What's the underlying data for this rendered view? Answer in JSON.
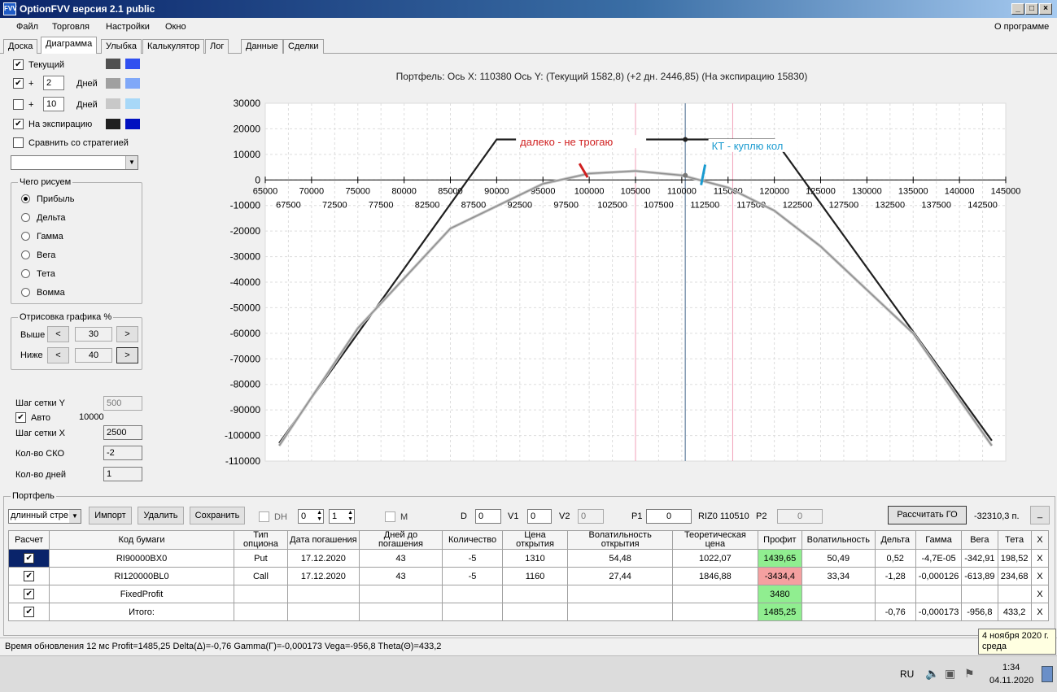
{
  "window": {
    "title": "OptionFVV версия 2.1 public",
    "min": "_",
    "max": "□",
    "close": "×"
  },
  "menu": {
    "items": [
      "Файл",
      "Торговля",
      "Настройки",
      "Окно"
    ],
    "about": "О программе"
  },
  "tabs": [
    "Доска",
    "Диаграмма",
    "Улыбка",
    "Калькулятор",
    "Лог",
    "Данные",
    "Сделки"
  ],
  "left": {
    "current": {
      "label": "Текущий",
      "checked": true,
      "c1": "#505050",
      "c2": "#3050f0"
    },
    "plus1": {
      "plus": "+",
      "days": "2",
      "unit": "Дней",
      "checked": true,
      "c1": "#a0a0a0",
      "c2": "#80a8f8"
    },
    "plus2": {
      "plus": "+",
      "days": "10",
      "unit": "Дней",
      "checked": false,
      "c1": "#c8c8c8",
      "c2": "#a8d8f8"
    },
    "expiry": {
      "label": "На экспирацию",
      "checked": true,
      "c1": "#202020",
      "c2": "#0010c0"
    },
    "compare": {
      "label": "Сравнить со стратегией",
      "checked": false
    },
    "what": {
      "title": "Чего рисуем",
      "options": [
        "Прибыль",
        "Дельта",
        "Гамма",
        "Вега",
        "Тета",
        "Вомма"
      ],
      "selected": 0
    },
    "draw": {
      "title": "Отрисовка графика %",
      "above_label": "Выше",
      "above": "30",
      "below_label": "Ниже",
      "below": "40",
      "prev": "<",
      "next": ">"
    },
    "grid": {
      "y_label": "Шаг сетки Y",
      "y": "500",
      "auto_label": "Авто",
      "auto": true,
      "auto_value": "10000",
      "x_label": "Шаг сетки X",
      "x": "2500",
      "sko_label": "Кол-во СКО",
      "sko": "-2",
      "days_label": "Кол-во дней",
      "days": "1"
    }
  },
  "chart_data": {
    "type": "line",
    "title": "Портфель: Ось X:  110380 Ось Y:   (Текущий 1582,8)  (+2 дн. 2446,85)  (На экспирацию 15830)",
    "xlim": [
      65000,
      145000
    ],
    "ylim": [
      -110000,
      30000
    ],
    "x_ticks_upper": [
      "65000",
      "70000",
      "75000",
      "80000",
      "85000",
      "90000",
      "95000",
      "100000",
      "105000",
      "110000",
      "115000",
      "120000",
      "125000",
      "130000",
      "135000",
      "140000",
      "145000"
    ],
    "x_ticks_lower": [
      "67500",
      "72500",
      "77500",
      "82500",
      "87500",
      "92500",
      "97500",
      "102500",
      "107500",
      "112500",
      "117500",
      "122500",
      "127500",
      "132500",
      "137500",
      "142500"
    ],
    "y_ticks": [
      "30000",
      "20000",
      "10000",
      "0",
      "-10000",
      "-20000",
      "-30000",
      "-40000",
      "-50000",
      "-60000",
      "-70000",
      "-80000",
      "-100000",
      "-110000",
      "-90000"
    ],
    "y_tick_values": [
      30000,
      20000,
      10000,
      0,
      -10000,
      -20000,
      -30000,
      -40000,
      -50000,
      -60000,
      -70000,
      -80000,
      -100000,
      -110000,
      -90000
    ],
    "cursor_x": 110380,
    "vlines": [
      105000,
      115500
    ],
    "series": [
      {
        "x": [
          66500,
          90000,
          120000,
          143500
        ],
        "y": [
          -103000,
          15830,
          15830,
          -102000
        ],
        "color": "#202020"
      },
      {
        "x": [
          66500,
          75000,
          85000,
          95000,
          100000,
          105000,
          110000,
          115000,
          120000,
          125000,
          135000,
          143500
        ],
        "y": [
          -104000,
          -58000,
          -19000,
          -1500,
          2500,
          3500,
          1800,
          -3000,
          -12000,
          -26000,
          -60000,
          -104000
        ],
        "color": "#909090"
      }
    ],
    "annotations": [
      {
        "text": "далеко - не трогаю",
        "color": "#d02020",
        "x": 100000,
        "y": 3000
      },
      {
        "text": "КТ - куплю кол",
        "color": "#1a9bd0",
        "x": 112000,
        "y": 0
      }
    ]
  },
  "portfolio": {
    "title": "Портфель",
    "select": "длинный стре",
    "import": "Импорт",
    "delete": "Удалить",
    "save": "Сохранить",
    "dh": "DH",
    "dh_v1": "0",
    "dh_v2": "1",
    "m": "M",
    "d_label": "D",
    "d": "0",
    "v1_label": "V1",
    "v1": "0",
    "v2_label": "V2",
    "v2": "0",
    "p1_label": "P1",
    "p1": "0",
    "riz": "RIZ0 110510",
    "p2_label": "P2",
    "p2": "0",
    "calc": "Рассчитать ГО",
    "go": "-32310,3 п.",
    "minus": "_",
    "headers": [
      "Расчет",
      "Код бумаги",
      "Тип опциона",
      "Дата погашения",
      "Дней до погашения",
      "Количество",
      "Цена открытия",
      "Волатильность открытия",
      "Теоретическая цена",
      "Профит",
      "Волатильность",
      "Дельта",
      "Гамма",
      "Вега",
      "Тета",
      "X"
    ],
    "rows": [
      [
        "RI90000BX0",
        "Put",
        "17.12.2020",
        "43",
        "-5",
        "1310",
        "54,48",
        "1022,07",
        "1439,65",
        "50,49",
        "0,52",
        "-4,7E-05",
        "-342,91",
        "198,52",
        "X"
      ],
      [
        "RI120000BL0",
        "Call",
        "17.12.2020",
        "43",
        "-5",
        "1160",
        "27,44",
        "1846,88",
        "-3434,4",
        "33,34",
        "-1,28",
        "-0,000126",
        "-613,89",
        "234,68",
        "X"
      ],
      [
        "FixedProfit",
        "",
        "",
        "",
        "",
        "",
        "",
        "",
        "3480",
        "",
        "",
        "",
        "",
        "",
        "X"
      ],
      [
        "Итого:",
        "",
        "",
        "",
        "",
        "",
        "",
        "",
        "1485,25",
        "",
        "-0,76",
        "-0,000173",
        "-956,8",
        "433,2",
        "X"
      ]
    ],
    "profit_colors": [
      "#90ee90",
      "#f4a0a0",
      "#90ee90",
      "#90ee90"
    ]
  },
  "status": {
    "text": "Время обновления 12 мс  Profit=1485,25 Delta(Δ)=-0,76 Gamma(Γ)=-0,000173 Vega=-956,8 Theta(Θ)=433,2"
  },
  "tooltip": {
    "line1": "4 ноября 2020 г.",
    "line2": "среда"
  },
  "taskbar": {
    "lang": "RU",
    "time": "1:34",
    "date": "04.11.2020"
  }
}
